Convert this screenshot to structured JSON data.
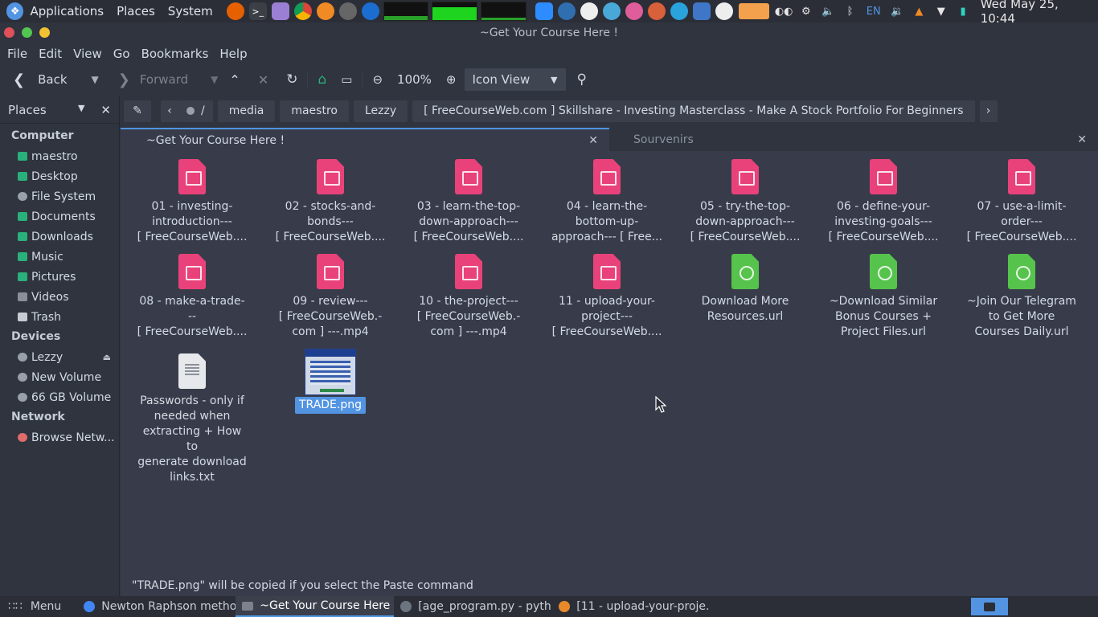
{
  "top_panel": {
    "menus": [
      "Applications",
      "Places",
      "System"
    ],
    "keyboard_layout": "EN",
    "clock": "Wed May 25, 10:44"
  },
  "window": {
    "title": "~Get Your Course Here !"
  },
  "menubar": [
    "File",
    "Edit",
    "View",
    "Go",
    "Bookmarks",
    "Help"
  ],
  "toolbar": {
    "back_label": "Back",
    "forward_label": "Forward",
    "zoom_level": "100%",
    "view_mode": "Icon View"
  },
  "sidebar": {
    "title": "Places",
    "groups": [
      {
        "name": "Computer",
        "items": [
          "maestro",
          "Desktop",
          "File System",
          "Documents",
          "Downloads",
          "Music",
          "Pictures",
          "Videos",
          "Trash"
        ]
      },
      {
        "name": "Devices",
        "items": [
          "Lezzy",
          "New Volume",
          "66 GB Volume"
        ]
      },
      {
        "name": "Network",
        "items": [
          "Browse Netw..."
        ]
      }
    ]
  },
  "pathbar": {
    "root": "/",
    "segments": [
      "media",
      "maestro",
      "Lezzy",
      "[ FreeCourseWeb.com ] Skillshare - Investing Masterclass - Make A Stock Portfolio For Beginners"
    ]
  },
  "tabs": [
    {
      "label": "~Get Your Course Here !",
      "active": true
    },
    {
      "label": "Sourvenirs",
      "active": false
    }
  ],
  "files": [
    {
      "type": "video",
      "lines": [
        "01 - investing-",
        "introduction---",
        "[ FreeCourseWeb...."
      ]
    },
    {
      "type": "video",
      "lines": [
        "02 - stocks-and-",
        "bonds---",
        "[ FreeCourseWeb...."
      ]
    },
    {
      "type": "video",
      "lines": [
        "03 - learn-the-top-",
        "down-approach---",
        "[ FreeCourseWeb...."
      ]
    },
    {
      "type": "video",
      "lines": [
        "04 - learn-the-",
        "bottom-up-",
        "approach--- [ Free..."
      ]
    },
    {
      "type": "video",
      "lines": [
        "05 - try-the-top-",
        "down-approach---",
        "[ FreeCourseWeb...."
      ]
    },
    {
      "type": "video",
      "lines": [
        "06 - define-your-",
        "investing-goals---",
        "[ FreeCourseWeb...."
      ]
    },
    {
      "type": "video",
      "lines": [
        "07 - use-a-limit-",
        "order---",
        "[ FreeCourseWeb...."
      ]
    },
    {
      "type": "video",
      "lines": [
        "08 - make-a-trade-",
        "--",
        "[ FreeCourseWeb...."
      ]
    },
    {
      "type": "video",
      "lines": [
        "09 - review---",
        "[ FreeCourseWeb.-",
        "com ] ---.mp4"
      ]
    },
    {
      "type": "video",
      "lines": [
        "10 - the-project---",
        "[ FreeCourseWeb.-",
        "com ] ---.mp4"
      ]
    },
    {
      "type": "video",
      "lines": [
        "11 - upload-your-",
        "project---",
        "[ FreeCourseWeb...."
      ]
    },
    {
      "type": "url",
      "lines": [
        "Download More",
        "Resources.url"
      ]
    },
    {
      "type": "url",
      "lines": [
        "~Download Similar",
        "Bonus Courses +",
        "Project Files.url"
      ]
    },
    {
      "type": "url",
      "lines": [
        "~Join Our Telegram",
        "to Get More",
        "Courses Daily.url"
      ]
    },
    {
      "type": "text",
      "lines": [
        "Passwords - only if",
        "needed when",
        "extracting + How to",
        "generate download",
        "links.txt"
      ]
    },
    {
      "type": "image",
      "lines": [
        "TRADE.png"
      ],
      "selected": true
    }
  ],
  "status": "\"TRADE.png\" will be copied if you select the Paste command",
  "taskbar": {
    "menu_label": "Menu",
    "tasks": [
      {
        "label": "Newton Raphson metho...",
        "active": false,
        "color": "#4285f4"
      },
      {
        "label": "~Get Your Course Here !",
        "active": true,
        "color": "#7c818c"
      },
      {
        "label": "[age_program.py - pyth...",
        "active": false,
        "color": "#6c7480"
      },
      {
        "label": "[11 - upload-your-proje...",
        "active": false,
        "color": "#e8892a"
      }
    ]
  },
  "colors": {
    "accent": "#5294e2",
    "video_icon": "#e9427a",
    "url_icon": "#56c34c",
    "window_close": "#e0505a",
    "window_max": "#52c552",
    "window_min": "#f1c232"
  }
}
